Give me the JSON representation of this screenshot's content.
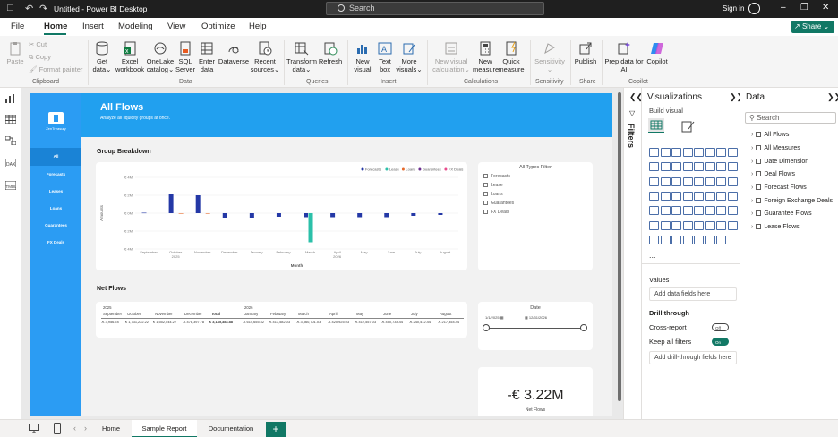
{
  "titlebar": {
    "doc_name": "Untitled",
    "app_name": " - Power BI Desktop",
    "search_placeholder": "Search",
    "sign_in": "Sign in"
  },
  "menu": {
    "tabs": [
      "File",
      "Home",
      "Insert",
      "Modeling",
      "View",
      "Optimize",
      "Help"
    ],
    "active": "Home",
    "share": "Share"
  },
  "ribbon": {
    "clipboard": {
      "paste": "Paste",
      "cut": "Cut",
      "copy": "Copy",
      "format_painter": "Format painter",
      "label": "Clipboard"
    },
    "data": {
      "buttons": [
        [
          "Get",
          "data"
        ],
        [
          "Excel",
          "workbook"
        ],
        [
          "OneLake",
          "catalog"
        ],
        [
          "SQL",
          "Server"
        ],
        [
          "Enter",
          "data"
        ],
        [
          "Dataverse",
          ""
        ],
        [
          "Recent",
          "sources"
        ]
      ],
      "label": "Data"
    },
    "queries": {
      "buttons": [
        [
          "Transform",
          "data"
        ],
        [
          "Refresh",
          ""
        ]
      ],
      "label": "Queries"
    },
    "insert": {
      "buttons": [
        [
          "New",
          "visual"
        ],
        [
          "Text",
          "box"
        ],
        [
          "More",
          "visuals"
        ]
      ],
      "label": "Insert"
    },
    "calculations": {
      "buttons": [
        [
          "New visual",
          "calculation"
        ],
        [
          "New",
          "measure"
        ],
        [
          "Quick",
          "measure"
        ]
      ],
      "label": "Calculations"
    },
    "sensitivity": {
      "buttons": [
        [
          "Sensitivity",
          ""
        ]
      ],
      "label": "Sensitivity"
    },
    "share": {
      "buttons": [
        [
          "Publish",
          ""
        ]
      ],
      "label": "Share"
    },
    "copilot": {
      "buttons": [
        [
          "Prep data for",
          "AI"
        ],
        [
          "Copilot",
          ""
        ]
      ],
      "label": "Copilot"
    }
  },
  "report": {
    "logo_text": "ZenTreasury",
    "nav": [
      "All",
      "Forecasts",
      "Leases",
      "Loans",
      "Guarantees",
      "FX Deals"
    ],
    "selected_nav": "All",
    "title": "All Flows",
    "subtitle": "Analyze all liquidity groups at once.",
    "group_title": "Group Breakdown",
    "net_title": "Net Flows",
    "filter_title": "All Types Filter",
    "filter_items": [
      "Forecasts",
      "Lease",
      "Loans",
      "Guarantees",
      "FX Deals"
    ],
    "date_title": "Date",
    "date_from": "1/1/2025",
    "date_to": "12/31/2026",
    "kpi_value": "-€ 3.22M",
    "kpi_label": "Net Flows",
    "matrix": {
      "years": {
        "y1": "2025",
        "y2": "2026"
      },
      "headers": [
        "September",
        "October",
        "November",
        "December",
        "Total",
        "January",
        "February",
        "March",
        "April",
        "May",
        "June",
        "July",
        "August"
      ],
      "values": [
        "-€ 3,956.78",
        "€ 1,731,222.22",
        "€ 1,552,544.22",
        "-€ 478,397.78",
        "€ 3,145,383.88",
        "-€ 614,655.52",
        "-€ 413,582.03",
        "-€ 3,560,701.03",
        "-€ 420,925.03",
        "-€ 412,557.03",
        "-€ 450,734.44",
        "-€ 240,412.44",
        "-€ 217,354.44"
      ]
    }
  },
  "chart_data": {
    "type": "bar",
    "title": "",
    "xlabel": "Month",
    "ylabel": "Amounts",
    "yticks": [
      "€ 4M",
      "€ 2M",
      "€ 0M",
      "-€ 2M",
      "-€ 4M"
    ],
    "ylim": [
      -4,
      4
    ],
    "legend_position": "top-right",
    "categories": [
      "September",
      "October",
      "November",
      "December",
      "January",
      "February",
      "March",
      "April",
      "May",
      "June",
      "July",
      "August"
    ],
    "year_labels": {
      "2025": "2025",
      "2026": "2026"
    },
    "series": [
      {
        "name": "Forecasts",
        "color": "#2438a6",
        "values": [
          0.05,
          2.1,
          2.0,
          -0.55,
          -0.6,
          -0.4,
          -0.45,
          -0.45,
          -0.45,
          -0.45,
          -0.3,
          -0.2
        ]
      },
      {
        "name": "Lease",
        "color": "#2bc0a9",
        "values": [
          0,
          0,
          0,
          0,
          0,
          0,
          -3.25,
          0,
          0,
          0,
          0,
          0
        ]
      },
      {
        "name": "Loans",
        "color": "#e56a2c",
        "values": [
          0,
          -0.05,
          -0.05,
          0,
          0,
          0,
          0,
          0,
          0,
          0,
          0,
          0
        ]
      },
      {
        "name": "Guarantees",
        "color": "#6b2e8f",
        "values": [
          0,
          0,
          0,
          0,
          0,
          0,
          0,
          0,
          0,
          0,
          0,
          0
        ]
      },
      {
        "name": "FX Deals",
        "color": "#e84c8c",
        "values": [
          0,
          0,
          0,
          0,
          0,
          0,
          0,
          0,
          0,
          0,
          0,
          0
        ]
      }
    ]
  },
  "viz": {
    "title": "Visualizations",
    "build": "Build visual",
    "values": "Values",
    "add_fields": "Add data fields here",
    "drill": "Drill through",
    "cross_report": "Cross-report",
    "cross_state": "Off",
    "keep_filters": "Keep all filters",
    "keep_state": "On",
    "add_drill": "Add drill-through fields here",
    "filters": "Filters",
    "more": "..."
  },
  "data": {
    "title": "Data",
    "search_placeholder": "Search",
    "items": [
      "All Flows",
      "All Measures",
      "Date Dimension",
      "Deal Flows",
      "Forecast Flows",
      "Foreign Exchange Deals",
      "Guarantee Flows",
      "Lease Flows"
    ]
  },
  "pages": {
    "tabs": [
      "Home",
      "Sample Report",
      "Documentation"
    ],
    "active": "Sample Report",
    "add": "+"
  }
}
